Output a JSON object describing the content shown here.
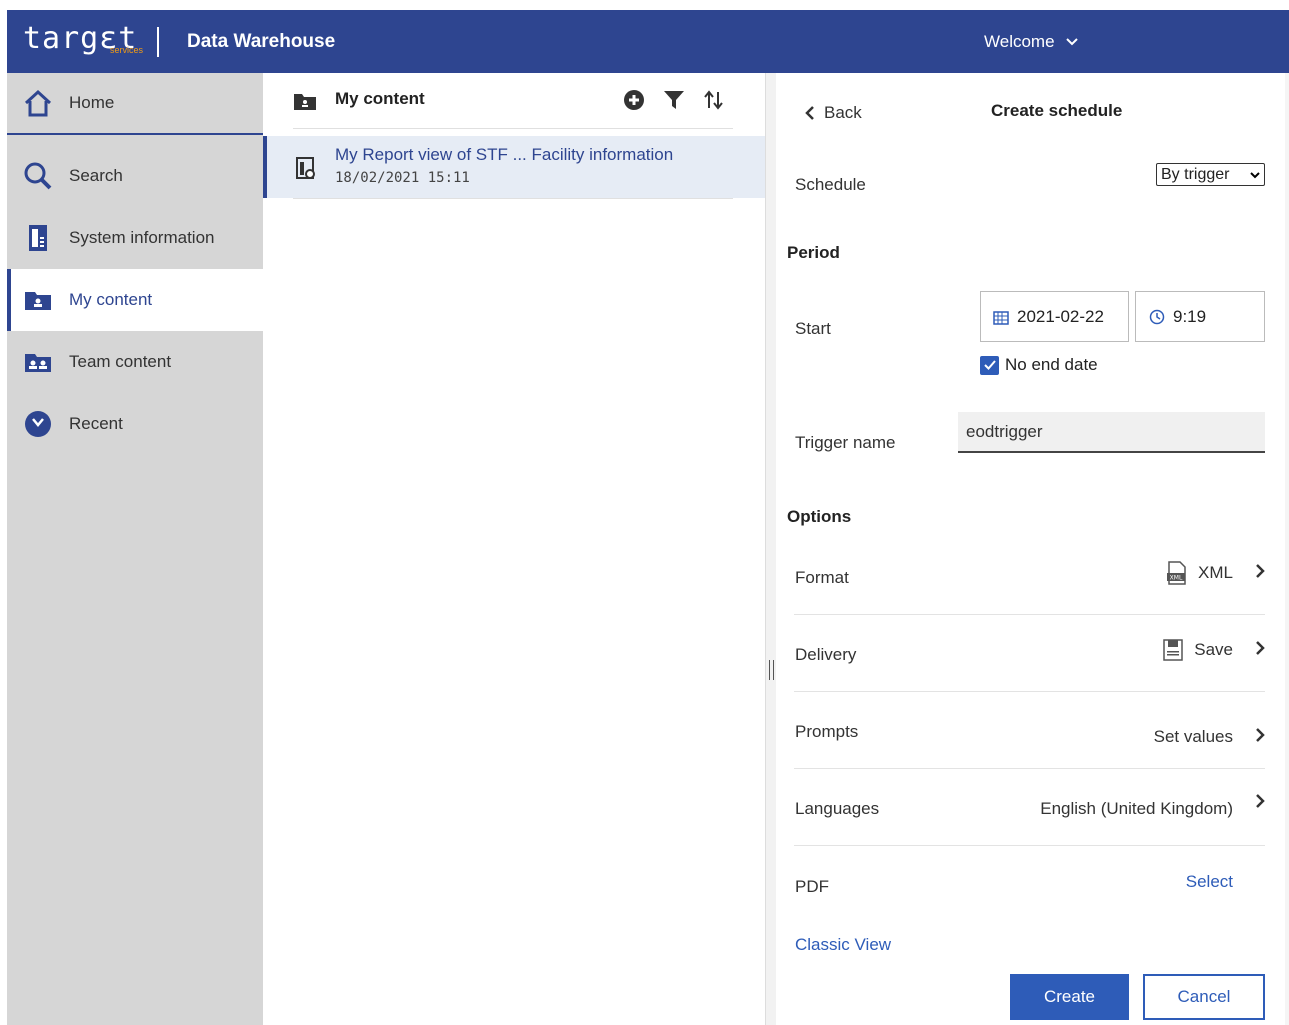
{
  "header": {
    "logo_text": "targεt",
    "logo_sub": "services",
    "title": "Data Warehouse",
    "welcome": "Welcome"
  },
  "sidebar": {
    "items": [
      {
        "label": "Home",
        "icon": "home-icon"
      },
      {
        "label": "Search",
        "icon": "search-icon"
      },
      {
        "label": "System information",
        "icon": "system-info-icon"
      },
      {
        "label": "My content",
        "icon": "my-content-icon"
      },
      {
        "label": "Team content",
        "icon": "team-content-icon"
      },
      {
        "label": "Recent",
        "icon": "recent-icon"
      }
    ],
    "active": "My content"
  },
  "content": {
    "title": "My content",
    "item_name": "My Report view of STF ... Facility information",
    "item_date": "18/02/2021 15:11"
  },
  "schedule": {
    "back": "Back",
    "title": "Create schedule",
    "schedule_label": "Schedule",
    "schedule_value": "By trigger",
    "period_heading": "Period",
    "start_label": "Start",
    "start_date": "2021-02-22",
    "start_time": "9:19",
    "no_end_date": "No end date",
    "no_end_date_checked": true,
    "trigger_label": "Trigger name",
    "trigger_value": "eodtrigger",
    "options_heading": "Options",
    "format_label": "Format",
    "format_value": "XML",
    "delivery_label": "Delivery",
    "delivery_value": "Save",
    "prompts_label": "Prompts",
    "prompts_value": "Set values",
    "languages_label": "Languages",
    "languages_value": "English (United Kingdom)",
    "pdf_label": "PDF",
    "pdf_value": "Select",
    "classic_view": "Classic View",
    "create": "Create",
    "cancel": "Cancel"
  },
  "colors": {
    "brand": "#2e4590",
    "accent": "#2e5cb8",
    "sidebar_bg": "#d6d6d6",
    "selected_row": "#e6ecf5"
  }
}
